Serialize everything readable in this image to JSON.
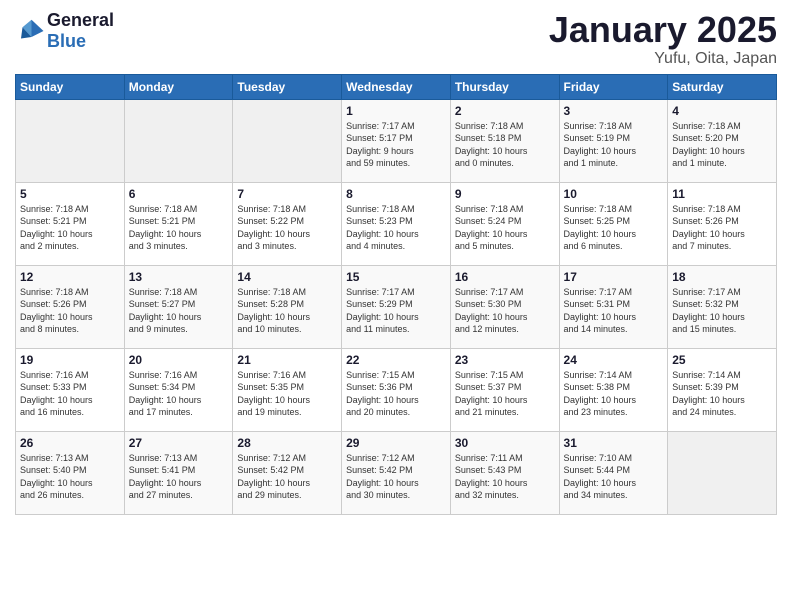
{
  "logo": {
    "line1": "General",
    "line2": "Blue"
  },
  "title": "January 2025",
  "subtitle": "Yufu, Oita, Japan",
  "weekdays": [
    "Sunday",
    "Monday",
    "Tuesday",
    "Wednesday",
    "Thursday",
    "Friday",
    "Saturday"
  ],
  "weeks": [
    [
      {
        "day": "",
        "detail": ""
      },
      {
        "day": "",
        "detail": ""
      },
      {
        "day": "",
        "detail": ""
      },
      {
        "day": "1",
        "detail": "Sunrise: 7:17 AM\nSunset: 5:17 PM\nDaylight: 9 hours\nand 59 minutes."
      },
      {
        "day": "2",
        "detail": "Sunrise: 7:18 AM\nSunset: 5:18 PM\nDaylight: 10 hours\nand 0 minutes."
      },
      {
        "day": "3",
        "detail": "Sunrise: 7:18 AM\nSunset: 5:19 PM\nDaylight: 10 hours\nand 1 minute."
      },
      {
        "day": "4",
        "detail": "Sunrise: 7:18 AM\nSunset: 5:20 PM\nDaylight: 10 hours\nand 1 minute."
      }
    ],
    [
      {
        "day": "5",
        "detail": "Sunrise: 7:18 AM\nSunset: 5:21 PM\nDaylight: 10 hours\nand 2 minutes."
      },
      {
        "day": "6",
        "detail": "Sunrise: 7:18 AM\nSunset: 5:21 PM\nDaylight: 10 hours\nand 3 minutes."
      },
      {
        "day": "7",
        "detail": "Sunrise: 7:18 AM\nSunset: 5:22 PM\nDaylight: 10 hours\nand 3 minutes."
      },
      {
        "day": "8",
        "detail": "Sunrise: 7:18 AM\nSunset: 5:23 PM\nDaylight: 10 hours\nand 4 minutes."
      },
      {
        "day": "9",
        "detail": "Sunrise: 7:18 AM\nSunset: 5:24 PM\nDaylight: 10 hours\nand 5 minutes."
      },
      {
        "day": "10",
        "detail": "Sunrise: 7:18 AM\nSunset: 5:25 PM\nDaylight: 10 hours\nand 6 minutes."
      },
      {
        "day": "11",
        "detail": "Sunrise: 7:18 AM\nSunset: 5:26 PM\nDaylight: 10 hours\nand 7 minutes."
      }
    ],
    [
      {
        "day": "12",
        "detail": "Sunrise: 7:18 AM\nSunset: 5:26 PM\nDaylight: 10 hours\nand 8 minutes."
      },
      {
        "day": "13",
        "detail": "Sunrise: 7:18 AM\nSunset: 5:27 PM\nDaylight: 10 hours\nand 9 minutes."
      },
      {
        "day": "14",
        "detail": "Sunrise: 7:18 AM\nSunset: 5:28 PM\nDaylight: 10 hours\nand 10 minutes."
      },
      {
        "day": "15",
        "detail": "Sunrise: 7:17 AM\nSunset: 5:29 PM\nDaylight: 10 hours\nand 11 minutes."
      },
      {
        "day": "16",
        "detail": "Sunrise: 7:17 AM\nSunset: 5:30 PM\nDaylight: 10 hours\nand 12 minutes."
      },
      {
        "day": "17",
        "detail": "Sunrise: 7:17 AM\nSunset: 5:31 PM\nDaylight: 10 hours\nand 14 minutes."
      },
      {
        "day": "18",
        "detail": "Sunrise: 7:17 AM\nSunset: 5:32 PM\nDaylight: 10 hours\nand 15 minutes."
      }
    ],
    [
      {
        "day": "19",
        "detail": "Sunrise: 7:16 AM\nSunset: 5:33 PM\nDaylight: 10 hours\nand 16 minutes."
      },
      {
        "day": "20",
        "detail": "Sunrise: 7:16 AM\nSunset: 5:34 PM\nDaylight: 10 hours\nand 17 minutes."
      },
      {
        "day": "21",
        "detail": "Sunrise: 7:16 AM\nSunset: 5:35 PM\nDaylight: 10 hours\nand 19 minutes."
      },
      {
        "day": "22",
        "detail": "Sunrise: 7:15 AM\nSunset: 5:36 PM\nDaylight: 10 hours\nand 20 minutes."
      },
      {
        "day": "23",
        "detail": "Sunrise: 7:15 AM\nSunset: 5:37 PM\nDaylight: 10 hours\nand 21 minutes."
      },
      {
        "day": "24",
        "detail": "Sunrise: 7:14 AM\nSunset: 5:38 PM\nDaylight: 10 hours\nand 23 minutes."
      },
      {
        "day": "25",
        "detail": "Sunrise: 7:14 AM\nSunset: 5:39 PM\nDaylight: 10 hours\nand 24 minutes."
      }
    ],
    [
      {
        "day": "26",
        "detail": "Sunrise: 7:13 AM\nSunset: 5:40 PM\nDaylight: 10 hours\nand 26 minutes."
      },
      {
        "day": "27",
        "detail": "Sunrise: 7:13 AM\nSunset: 5:41 PM\nDaylight: 10 hours\nand 27 minutes."
      },
      {
        "day": "28",
        "detail": "Sunrise: 7:12 AM\nSunset: 5:42 PM\nDaylight: 10 hours\nand 29 minutes."
      },
      {
        "day": "29",
        "detail": "Sunrise: 7:12 AM\nSunset: 5:42 PM\nDaylight: 10 hours\nand 30 minutes."
      },
      {
        "day": "30",
        "detail": "Sunrise: 7:11 AM\nSunset: 5:43 PM\nDaylight: 10 hours\nand 32 minutes."
      },
      {
        "day": "31",
        "detail": "Sunrise: 7:10 AM\nSunset: 5:44 PM\nDaylight: 10 hours\nand 34 minutes."
      },
      {
        "day": "",
        "detail": ""
      }
    ]
  ]
}
